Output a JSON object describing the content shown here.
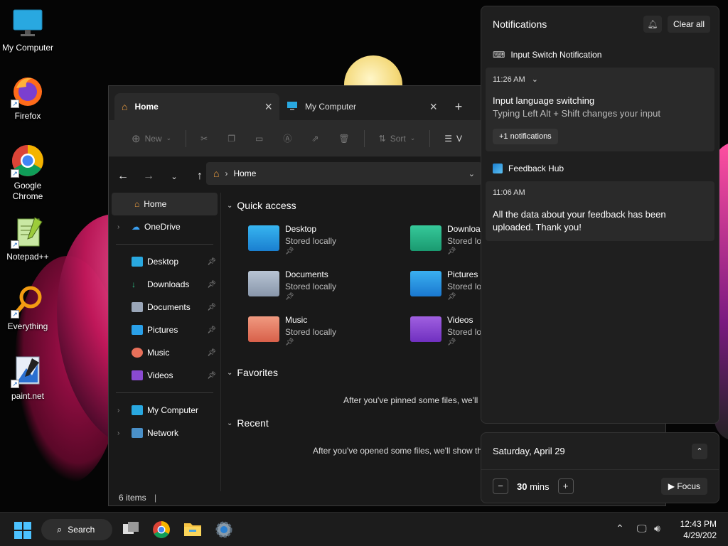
{
  "desktop": {
    "icons": [
      {
        "label": "My Computer"
      },
      {
        "label": "Firefox"
      },
      {
        "label": "Google Chrome"
      },
      {
        "label": "Notepad++"
      },
      {
        "label": "Everything"
      },
      {
        "label": "paint.net"
      }
    ]
  },
  "explorer": {
    "tabs": [
      {
        "label": "Home"
      },
      {
        "label": "My Computer"
      }
    ],
    "toolbar": {
      "new_label": "New",
      "sort_label": "Sort",
      "view_label": "V"
    },
    "address": "Home",
    "sidebar": {
      "items": [
        {
          "label": "Home"
        },
        {
          "label": "OneDrive"
        },
        {
          "label": "Desktop"
        },
        {
          "label": "Downloads"
        },
        {
          "label": "Documents"
        },
        {
          "label": "Pictures"
        },
        {
          "label": "Music"
        },
        {
          "label": "Videos"
        },
        {
          "label": "My Computer"
        },
        {
          "label": "Network"
        }
      ]
    },
    "sections": {
      "quick_access": "Quick access",
      "favorites": "Favorites",
      "recent": "Recent"
    },
    "quick_access": [
      {
        "name": "Desktop",
        "status": "Stored locally"
      },
      {
        "name": "Downloa",
        "status": "Stored lo"
      },
      {
        "name": "Documents",
        "status": "Stored locally"
      },
      {
        "name": "Pictures",
        "status": "Stored loc"
      },
      {
        "name": "Music",
        "status": "Stored locally"
      },
      {
        "name": "Videos",
        "status": "Stored loc"
      }
    ],
    "favorites_empty": "After you've pinned some files, we'll",
    "recent_empty": "After you've opened some files, we'll show th",
    "status": "6 items"
  },
  "notifications": {
    "title": "Notifications",
    "clear_all": "Clear all",
    "groups": [
      {
        "app": "Input Switch Notification",
        "time": "11:26 AM",
        "title": "Input language switching",
        "body": "Typing Left Alt + Shift changes your input",
        "more": "+1 notifications"
      },
      {
        "app": "Feedback Hub",
        "time": "11:06 AM",
        "body": "All the data about your feedback has been uploaded. Thank you!"
      }
    ]
  },
  "focus": {
    "date": "Saturday, April 29",
    "minutes": "30",
    "unit": "mins",
    "button": "Focus"
  },
  "taskbar": {
    "search_label": "Search",
    "time": "12:43 PM",
    "date": "4/29/202"
  }
}
